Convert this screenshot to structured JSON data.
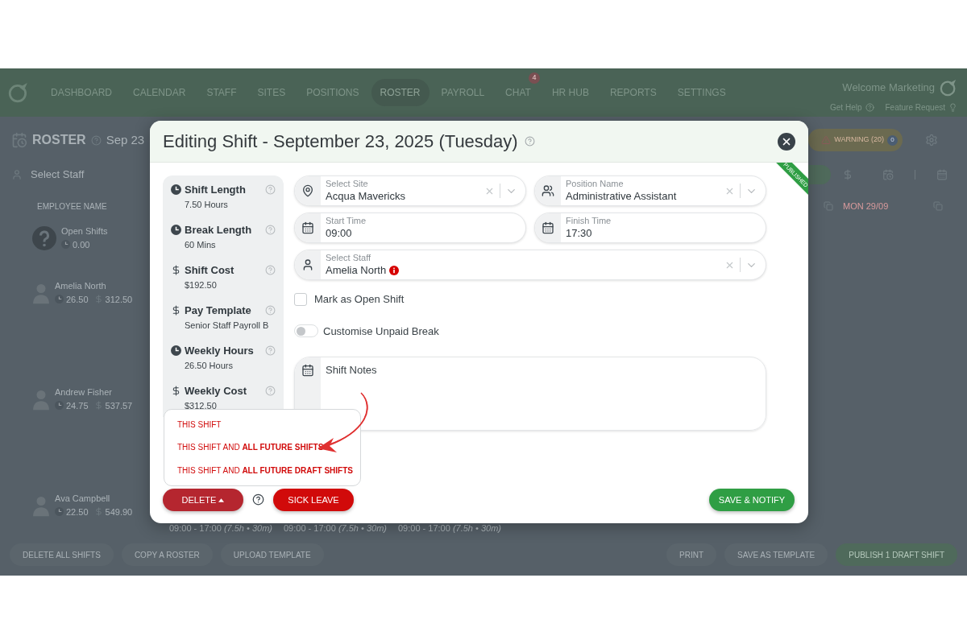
{
  "nav": {
    "items": [
      {
        "label": "DASHBOARD",
        "selected": false
      },
      {
        "label": "CALENDAR",
        "selected": false
      },
      {
        "label": "STAFF",
        "selected": false
      },
      {
        "label": "SITES",
        "selected": false
      },
      {
        "label": "POSITIONS",
        "selected": false
      },
      {
        "label": "ROSTER",
        "selected": true
      },
      {
        "label": "PAYROLL",
        "selected": false
      },
      {
        "label": "CHAT",
        "selected": false,
        "badge": "4"
      },
      {
        "label": "HR HUB",
        "selected": false
      },
      {
        "label": "REPORTS",
        "selected": false
      },
      {
        "label": "SETTINGS",
        "selected": false
      }
    ],
    "welcome": "Welcome Marketing",
    "links": [
      "Get Help",
      "Feature Request"
    ]
  },
  "roster": {
    "title": "ROSTER",
    "date": "Sep 23",
    "warning": "WARNING (20)",
    "warning_count": "0",
    "staff_placeholder": "Select Staff",
    "column_header": "EMPLOYEE NAME",
    "day_header": "MON 29/09",
    "employees": [
      {
        "kind": "open",
        "name": "Open Shifts",
        "hours": "0.00"
      },
      {
        "kind": "staff",
        "name": "Amelia North",
        "hours": "26.50",
        "cost": "312.50"
      },
      {
        "kind": "staff",
        "name": "Andrew Fisher",
        "hours": "24.75",
        "cost": "537.57"
      },
      {
        "kind": "staff",
        "name": "Ava Campbell",
        "hours": "22.50",
        "cost": "549.90"
      }
    ],
    "shift_texts": [
      "09:00 - 17:00 *(7.5h • 30m)*",
      "09:00 - 17:00 *(7.5h • 30m)*",
      "09:00 - 17:00 *(7.5h • 30m)*"
    ],
    "footer_left": [
      "DELETE ALL SHIFTS",
      "COPY A ROSTER",
      "UPLOAD TEMPLATE"
    ],
    "footer_right": [
      {
        "label": "PRINT",
        "kind": "plain"
      },
      {
        "label": "SAVE AS TEMPLATE",
        "kind": "plain"
      },
      {
        "label": "PUBLISH 1 DRAFT SHIFT",
        "kind": "primary"
      }
    ]
  },
  "modal": {
    "title": "Editing Shift - September 23, 2025 (Tuesday)",
    "ribbon": "PUBLISHED",
    "summary": [
      {
        "kind": "time",
        "label": "Shift Length",
        "value": "7.50 Hours"
      },
      {
        "kind": "time",
        "label": "Break Length",
        "value": "60 Mins"
      },
      {
        "kind": "money",
        "label": "Shift Cost",
        "value": "$192.50"
      },
      {
        "kind": "money",
        "label": "Pay Template",
        "value": "Senior Staff Payroll B"
      },
      {
        "kind": "time",
        "label": "Weekly Hours",
        "value": "26.50 Hours"
      },
      {
        "kind": "money",
        "label": "Weekly Cost",
        "value": "$312.50"
      }
    ],
    "site": {
      "label": "Select Site",
      "value": "Acqua Mavericks"
    },
    "position": {
      "label": "Position Name",
      "value": "Administrative Assistant"
    },
    "start": {
      "label": "Start Time",
      "value": "09:00"
    },
    "finish": {
      "label": "Finish Time",
      "value": "17:30"
    },
    "staff": {
      "label": "Select Staff",
      "value": "Amelia North",
      "warning": true
    },
    "open_shift": {
      "label": "Mark as Open Shift",
      "checked": false
    },
    "unpaid_break": {
      "label": "Customise Unpaid Break",
      "on": false
    },
    "notes": {
      "placeholder": "Shift Notes"
    },
    "delete": {
      "label": "DELETE",
      "expanded": true,
      "options": [
        "THIS SHIFT",
        "THIS SHIFT AND **ALL FUTURE SHIFTS**",
        "THIS SHIFT AND **ALL FUTURE DRAFT SHIFTS**"
      ]
    },
    "sick_leave": "SICK LEAVE",
    "save": "SAVE & NOTIFY"
  }
}
